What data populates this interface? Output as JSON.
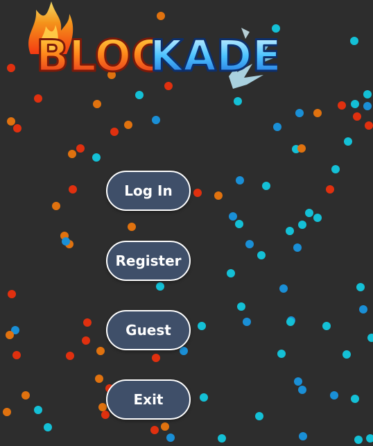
{
  "game": {
    "title": "BLOCKADE",
    "title_part_fire": "BLOC",
    "title_part_ice": "KADE"
  },
  "menu": {
    "login_label": "Log In",
    "register_label": "Register",
    "guest_label": "Guest",
    "exit_label": "Exit"
  },
  "colors": {
    "background": "#2d2d2d",
    "button_fill": "#3f4f69",
    "button_border": "#ffffff",
    "particle_red": "#e0300f",
    "particle_orange": "#e0720f",
    "particle_blue": "#1a8fd6",
    "particle_cyan": "#14c0d6"
  },
  "icons": {
    "logo": "blockade-fire-ice-logo"
  }
}
